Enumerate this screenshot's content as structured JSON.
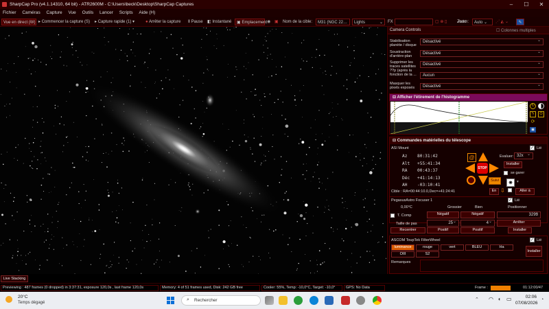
{
  "titlebar": {
    "title": "SharpCap Pro (v4.1.14310, 64 bit) - ATR2600M - C:\\Users\\beck\\Desktop\\SharpCap Captures"
  },
  "menu": [
    "Fichier",
    "Caméras",
    "Capture",
    "Vue",
    "Outils",
    "Lancer",
    "Scripts",
    "Aide (H)"
  ],
  "toolbar": {
    "live": "Vue en direct (W)",
    "start": "Commencer la capture (S)",
    "quick": "Capture rapide (1)",
    "stop": "Arrêter la capture",
    "pause": "Pause",
    "snapshot": "Instantané",
    "location": "Emplacement",
    "target_label": "Nom de la cible:",
    "target_value": "M31 (NGC 22…",
    "frame_type": "Lights",
    "fx": "FX",
    "zoom_label": "Zoom:",
    "zoom_value": "Auto"
  },
  "live_stacking": "Live Stacking",
  "camera_controls": {
    "title": "Camera Controls",
    "multi_columns": "Colonnes multiples",
    "rows": [
      {
        "label": "Stabilisation planète / disque",
        "value": "Désactivé"
      },
      {
        "label": "Soustraction d'arrière-plan",
        "value": "Désactivé"
      },
      {
        "label": "Supprimer les traces satellites ??p (après la fonction de la ...",
        "value": "Désactivé"
      },
      {
        "label": "",
        "value": "Aucun"
      },
      {
        "label": "Masquer les pixels exposés",
        "value": "Désactivé"
      }
    ]
  },
  "histogram": {
    "title": "Afficher l'étirement de l'histogramme"
  },
  "telescope": {
    "title": "Commandes matérielles du télescope",
    "mount": "ASI Mount",
    "linked": "Lié",
    "coords": [
      {
        "k": "Az",
        "v": "80:31:42"
      },
      {
        "k": "Alt",
        "v": "+55:41:34"
      },
      {
        "k": "RA",
        "v": "00:43:37"
      },
      {
        "k": "Déc",
        "v": "+41:14:13"
      },
      {
        "k": "AH",
        "v": "-03:10:41"
      }
    ],
    "rate_label": "Evaluer:",
    "rate_value": "32x",
    "install": "Installer",
    "park": "se garer",
    "stop": "STOP",
    "follow": "Suivi",
    "target": "Cible : RA=00:44:10.0,Dec=+41:24:41",
    "goto": "Aller à",
    "en": "En"
  },
  "focuser": {
    "title": "PegasusAstro Focuser 1",
    "linked": "Lié",
    "temp": "0,00°C",
    "col_coarse": "Grossier",
    "col_fine": "Bien",
    "col_pos": "Positionner",
    "tcomp": "T. Comp",
    "neg1": "Négatif",
    "neg2": "Négatif",
    "position": "3293",
    "step_label": "Taille de pas",
    "step_coarse": "25",
    "step_fine": "4",
    "stop": "Arrêter",
    "recenter": "Recentrer",
    "pos1": "Positif",
    "pos2": "Positif",
    "install": "Installer"
  },
  "filterwheel": {
    "title": "ASCOM ToupTek FilterWheel",
    "linked": "Lié",
    "filters": [
      "luminance",
      "rouge",
      "vert",
      "BLEU",
      "Ha",
      "OIII",
      "S2"
    ],
    "install": "Installer",
    "remarks": "Remarques"
  },
  "status": {
    "previewing": "Previewing : 487 frames (0 dropped) in 3:37:31, exposure 120,0s , last frame 120,0s",
    "memory": "Memory: 4 of 51 frames used, Disk: 242 GB free",
    "cooler": "Cooler: 55%, Temp: -10,0°C, Target: -10,0°",
    "gps": "GPS: No Data",
    "frame_label": "Frame :",
    "elapsed": "01:12:00/47"
  },
  "taskbar": {
    "weather_temp": "20°C",
    "weather_desc": "Temps dégagé",
    "search": "Rechercher",
    "time": "02:06",
    "date": "07/08/2026"
  }
}
